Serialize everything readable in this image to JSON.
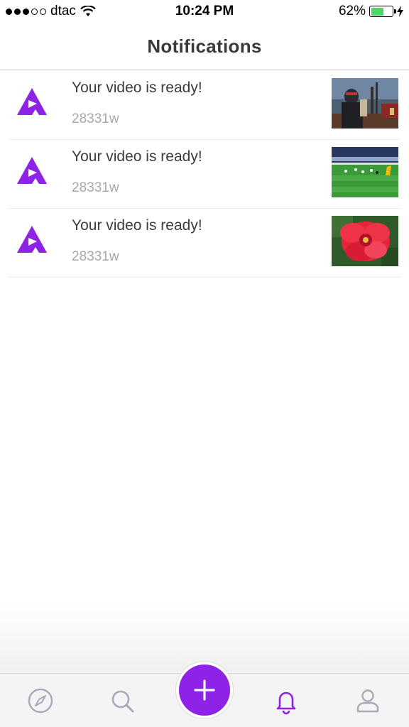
{
  "status_bar": {
    "carrier": "dtac",
    "time": "10:24 PM",
    "battery_percent_label": "62%",
    "battery_level": 0.62
  },
  "header": {
    "title": "Notifications"
  },
  "notifications": [
    {
      "title": "Your video is ready!",
      "time": "28331w",
      "thumbnail": "video-game-knight-thumbnail"
    },
    {
      "title": "Your video is ready!",
      "time": "28331w",
      "thumbnail": "soccer-match-thumbnail"
    },
    {
      "title": "Your video is ready!",
      "time": "28331w",
      "thumbnail": "red-flower-thumbnail"
    }
  ],
  "tabbar": {
    "items": [
      {
        "icon": "compass-icon",
        "active": false
      },
      {
        "icon": "search-icon",
        "active": false
      },
      {
        "icon": "plus-icon",
        "active": false
      },
      {
        "icon": "bell-icon",
        "active": true
      },
      {
        "icon": "profile-icon",
        "active": false
      }
    ]
  },
  "colors": {
    "accent": "#8e22e6",
    "inactive_icon": "#a8a8b8",
    "battery": "#4cd964"
  }
}
